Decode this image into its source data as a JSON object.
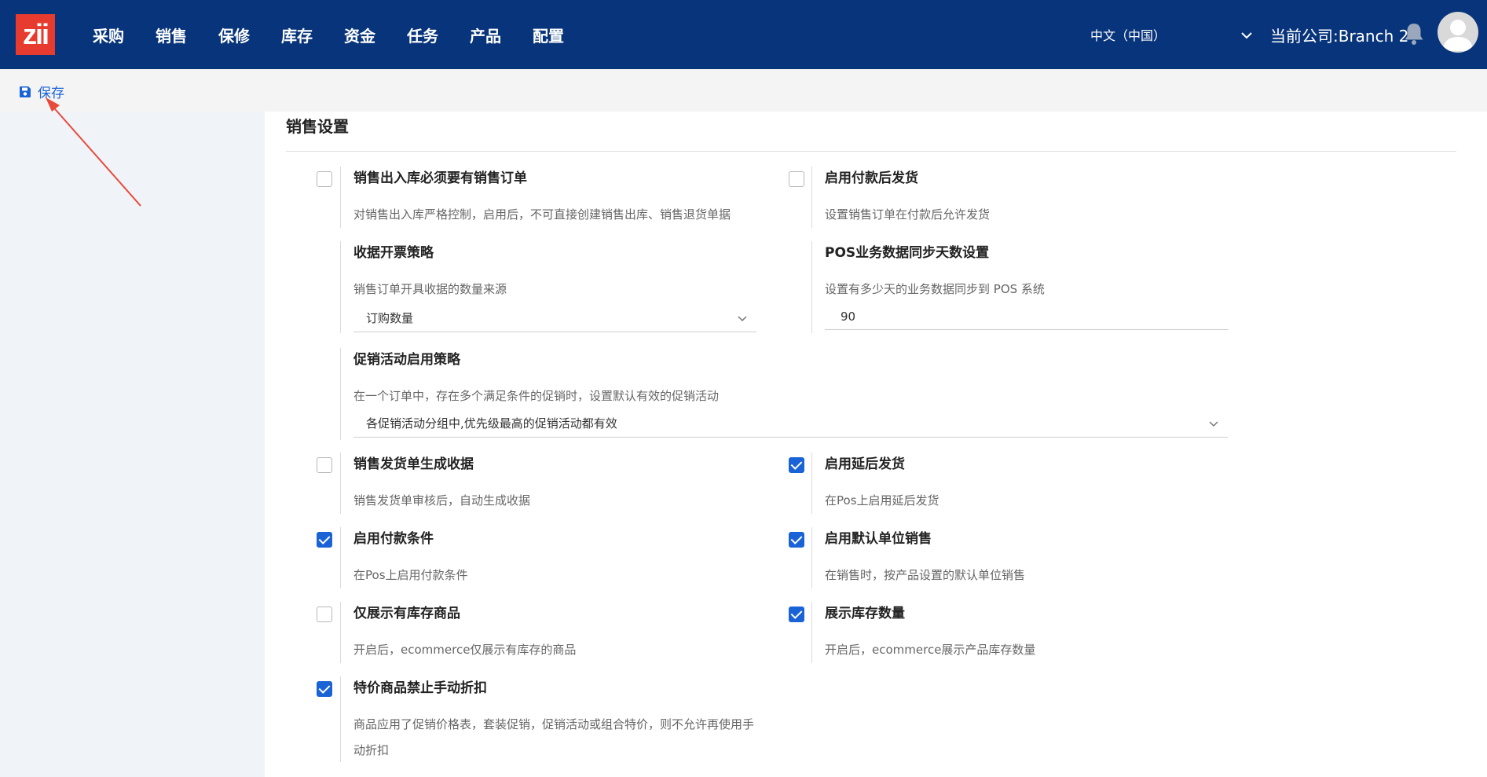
{
  "header": {
    "logo_text": "zii",
    "nav": [
      "采购",
      "销售",
      "保修",
      "库存",
      "资金",
      "任务",
      "产品",
      "配置"
    ],
    "language": "中文（中国）",
    "company": "当前公司:Branch 2",
    "brand_color": "#07347a",
    "logo_color": "#e63b2e"
  },
  "toolbar": {
    "save_label": "保存"
  },
  "section": {
    "title": "销售设置"
  },
  "settings": {
    "require_order": {
      "label": "销售出入库必须要有销售订单",
      "desc": "对销售出入库严格控制，启用后，不可直接创建销售出库、销售退货单据",
      "checked": false
    },
    "ship_after_pay": {
      "label": "启用付款后发货",
      "desc": "设置销售订单在付款后允许发货",
      "checked": false
    },
    "receipt_strategy": {
      "label": "收据开票策略",
      "desc": "销售订单开具收据的数量来源",
      "value": "订购数量"
    },
    "pos_sync_days": {
      "label": "POS业务数据同步天数设置",
      "desc": "设置有多少天的业务数据同步到 POS 系统",
      "value": "90"
    },
    "promo_strategy": {
      "label": "促销活动启用策略",
      "desc": "在一个订单中，存在多个满足条件的促销时，设置默认有效的促销活动",
      "value": "各促销活动分组中,优先级最高的促销活动都有效"
    },
    "delivery_receipt": {
      "label": "销售发货单生成收据",
      "desc": "销售发货单审核后，自动生成收据",
      "checked": false
    },
    "delayed_delivery": {
      "label": "启用延后发货",
      "desc": "在Pos上启用延后发货",
      "checked": true
    },
    "payment_terms": {
      "label": "启用付款条件",
      "desc": "在Pos上启用付款条件",
      "checked": true
    },
    "default_unit": {
      "label": "启用默认单位销售",
      "desc": "在销售时，按产品设置的默认单位销售",
      "checked": true
    },
    "in_stock_only": {
      "label": "仅展示有库存商品",
      "desc": "开启后，ecommerce仅展示有库存的商品",
      "checked": false
    },
    "show_stock_qty": {
      "label": "展示库存数量",
      "desc": "开启后，ecommerce展示产品库存数量",
      "checked": true
    },
    "no_manual_discount": {
      "label": "特价商品禁止手动折扣",
      "desc": "商品应用了促销价格表，套装促销，促销活动或组合特价，则不允许再使用手动折扣",
      "checked": true
    }
  }
}
